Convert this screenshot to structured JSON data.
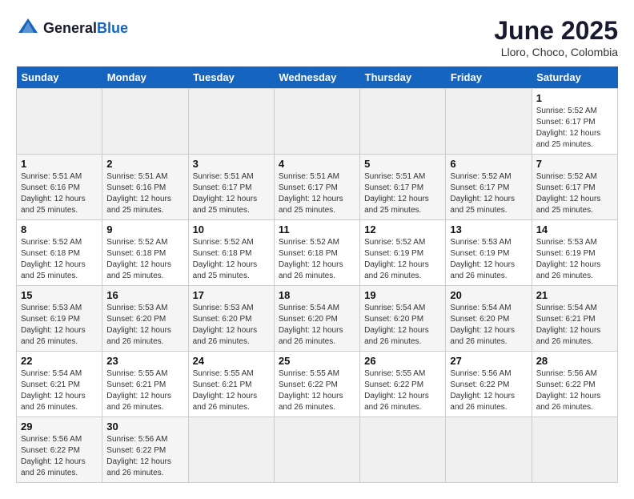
{
  "header": {
    "logo_general": "General",
    "logo_blue": "Blue",
    "title": "June 2025",
    "location": "Lloro, Choco, Colombia"
  },
  "calendar": {
    "days_of_week": [
      "Sunday",
      "Monday",
      "Tuesday",
      "Wednesday",
      "Thursday",
      "Friday",
      "Saturday"
    ],
    "weeks": [
      [
        {
          "day": "",
          "empty": true
        },
        {
          "day": "",
          "empty": true
        },
        {
          "day": "",
          "empty": true
        },
        {
          "day": "",
          "empty": true
        },
        {
          "day": "",
          "empty": true
        },
        {
          "day": "",
          "empty": true
        },
        {
          "day": "1",
          "sunrise": "5:52 AM",
          "sunset": "6:17 PM",
          "daylight": "12 hours and 25 minutes."
        }
      ],
      [
        {
          "day": "1",
          "sunrise": "5:51 AM",
          "sunset": "6:16 PM",
          "daylight": "12 hours and 25 minutes."
        },
        {
          "day": "2",
          "sunrise": "5:51 AM",
          "sunset": "6:16 PM",
          "daylight": "12 hours and 25 minutes."
        },
        {
          "day": "3",
          "sunrise": "5:51 AM",
          "sunset": "6:17 PM",
          "daylight": "12 hours and 25 minutes."
        },
        {
          "day": "4",
          "sunrise": "5:51 AM",
          "sunset": "6:17 PM",
          "daylight": "12 hours and 25 minutes."
        },
        {
          "day": "5",
          "sunrise": "5:51 AM",
          "sunset": "6:17 PM",
          "daylight": "12 hours and 25 minutes."
        },
        {
          "day": "6",
          "sunrise": "5:52 AM",
          "sunset": "6:17 PM",
          "daylight": "12 hours and 25 minutes."
        },
        {
          "day": "7",
          "sunrise": "5:52 AM",
          "sunset": "6:17 PM",
          "daylight": "12 hours and 25 minutes."
        }
      ],
      [
        {
          "day": "8",
          "sunrise": "5:52 AM",
          "sunset": "6:18 PM",
          "daylight": "12 hours and 25 minutes."
        },
        {
          "day": "9",
          "sunrise": "5:52 AM",
          "sunset": "6:18 PM",
          "daylight": "12 hours and 25 minutes."
        },
        {
          "day": "10",
          "sunrise": "5:52 AM",
          "sunset": "6:18 PM",
          "daylight": "12 hours and 25 minutes."
        },
        {
          "day": "11",
          "sunrise": "5:52 AM",
          "sunset": "6:18 PM",
          "daylight": "12 hours and 26 minutes."
        },
        {
          "day": "12",
          "sunrise": "5:52 AM",
          "sunset": "6:19 PM",
          "daylight": "12 hours and 26 minutes."
        },
        {
          "day": "13",
          "sunrise": "5:53 AM",
          "sunset": "6:19 PM",
          "daylight": "12 hours and 26 minutes."
        },
        {
          "day": "14",
          "sunrise": "5:53 AM",
          "sunset": "6:19 PM",
          "daylight": "12 hours and 26 minutes."
        }
      ],
      [
        {
          "day": "15",
          "sunrise": "5:53 AM",
          "sunset": "6:19 PM",
          "daylight": "12 hours and 26 minutes."
        },
        {
          "day": "16",
          "sunrise": "5:53 AM",
          "sunset": "6:20 PM",
          "daylight": "12 hours and 26 minutes."
        },
        {
          "day": "17",
          "sunrise": "5:53 AM",
          "sunset": "6:20 PM",
          "daylight": "12 hours and 26 minutes."
        },
        {
          "day": "18",
          "sunrise": "5:54 AM",
          "sunset": "6:20 PM",
          "daylight": "12 hours and 26 minutes."
        },
        {
          "day": "19",
          "sunrise": "5:54 AM",
          "sunset": "6:20 PM",
          "daylight": "12 hours and 26 minutes."
        },
        {
          "day": "20",
          "sunrise": "5:54 AM",
          "sunset": "6:20 PM",
          "daylight": "12 hours and 26 minutes."
        },
        {
          "day": "21",
          "sunrise": "5:54 AM",
          "sunset": "6:21 PM",
          "daylight": "12 hours and 26 minutes."
        }
      ],
      [
        {
          "day": "22",
          "sunrise": "5:54 AM",
          "sunset": "6:21 PM",
          "daylight": "12 hours and 26 minutes."
        },
        {
          "day": "23",
          "sunrise": "5:55 AM",
          "sunset": "6:21 PM",
          "daylight": "12 hours and 26 minutes."
        },
        {
          "day": "24",
          "sunrise": "5:55 AM",
          "sunset": "6:21 PM",
          "daylight": "12 hours and 26 minutes."
        },
        {
          "day": "25",
          "sunrise": "5:55 AM",
          "sunset": "6:22 PM",
          "daylight": "12 hours and 26 minutes."
        },
        {
          "day": "26",
          "sunrise": "5:55 AM",
          "sunset": "6:22 PM",
          "daylight": "12 hours and 26 minutes."
        },
        {
          "day": "27",
          "sunrise": "5:56 AM",
          "sunset": "6:22 PM",
          "daylight": "12 hours and 26 minutes."
        },
        {
          "day": "28",
          "sunrise": "5:56 AM",
          "sunset": "6:22 PM",
          "daylight": "12 hours and 26 minutes."
        }
      ],
      [
        {
          "day": "29",
          "sunrise": "5:56 AM",
          "sunset": "6:22 PM",
          "daylight": "12 hours and 26 minutes."
        },
        {
          "day": "30",
          "sunrise": "5:56 AM",
          "sunset": "6:22 PM",
          "daylight": "12 hours and 26 minutes."
        },
        {
          "day": "",
          "empty": true
        },
        {
          "day": "",
          "empty": true
        },
        {
          "day": "",
          "empty": true
        },
        {
          "day": "",
          "empty": true
        },
        {
          "day": "",
          "empty": true
        }
      ]
    ]
  }
}
